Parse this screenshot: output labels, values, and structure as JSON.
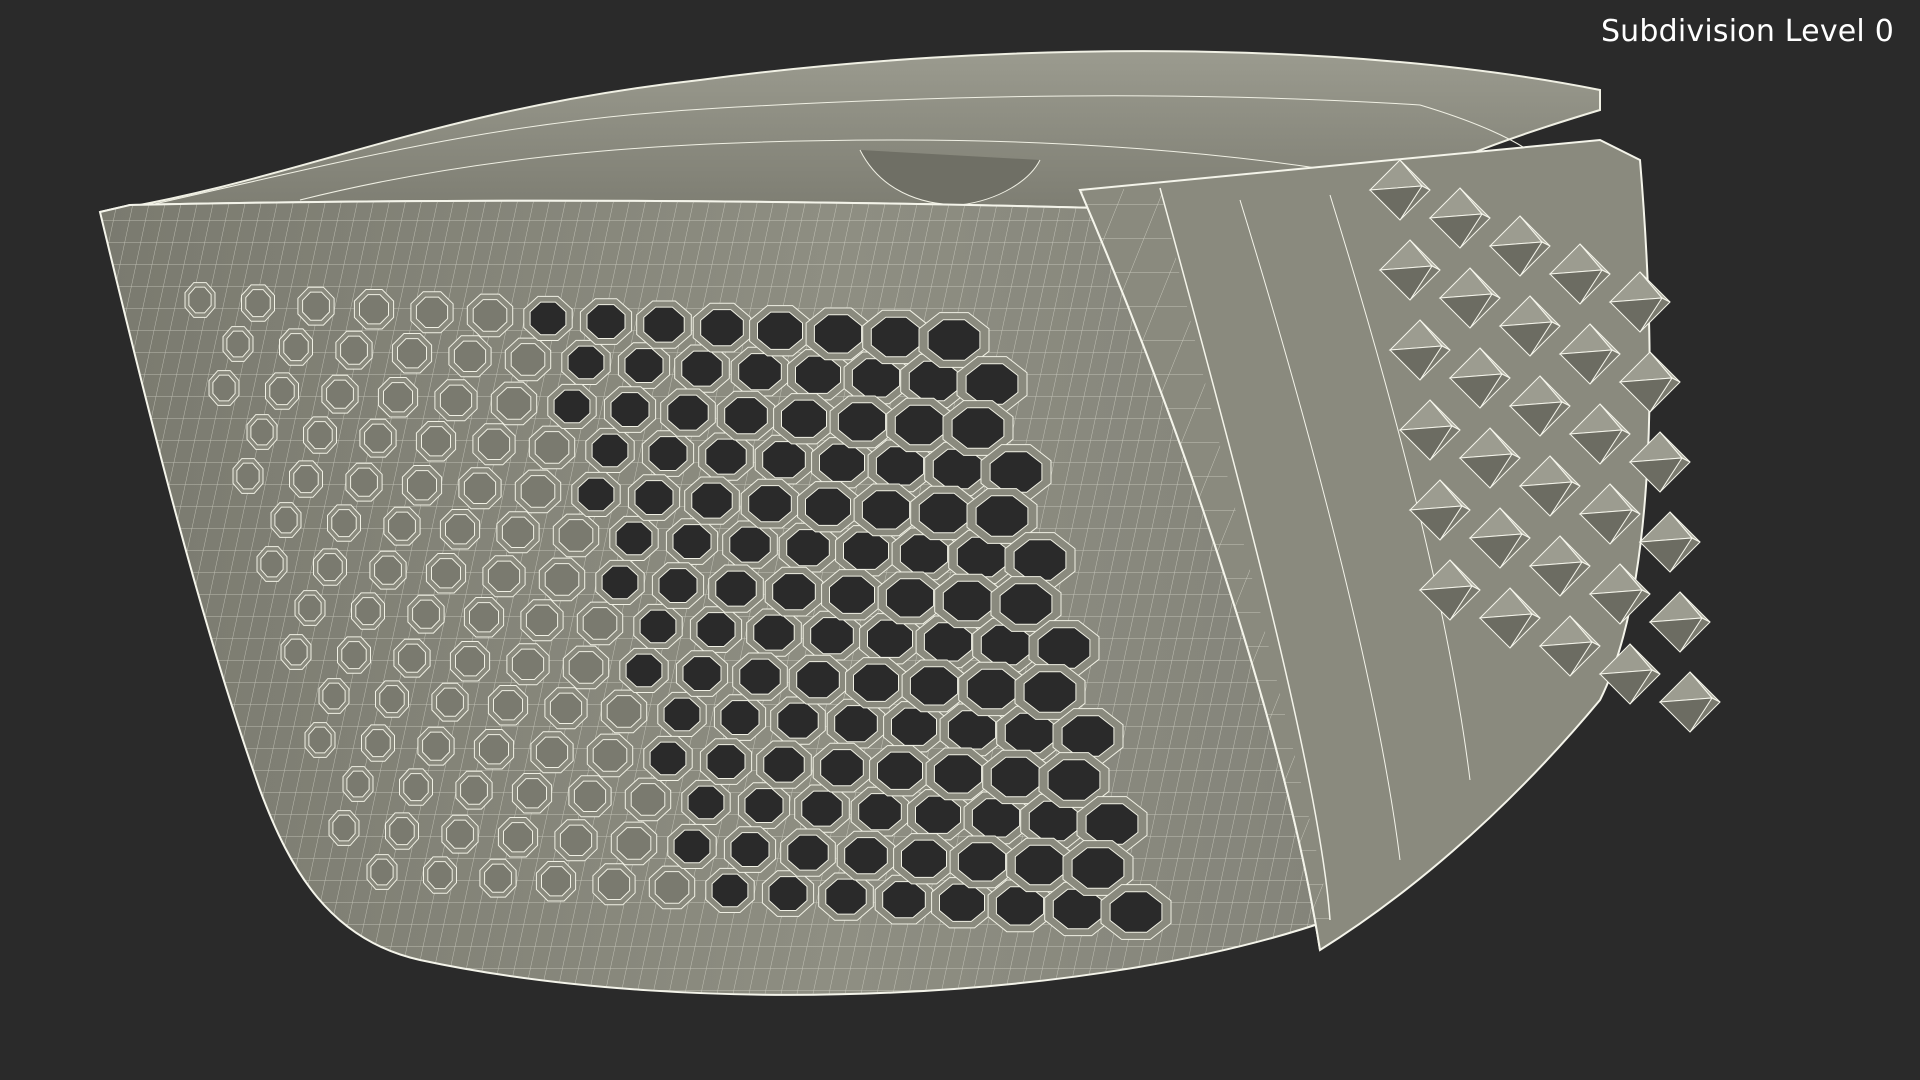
{
  "viewport": {
    "overlay_label": "Subdivision Level 0",
    "background_color": "#2a2a2a",
    "model_color": "#8b8b7f",
    "wire_color": "#f4f4ea"
  }
}
